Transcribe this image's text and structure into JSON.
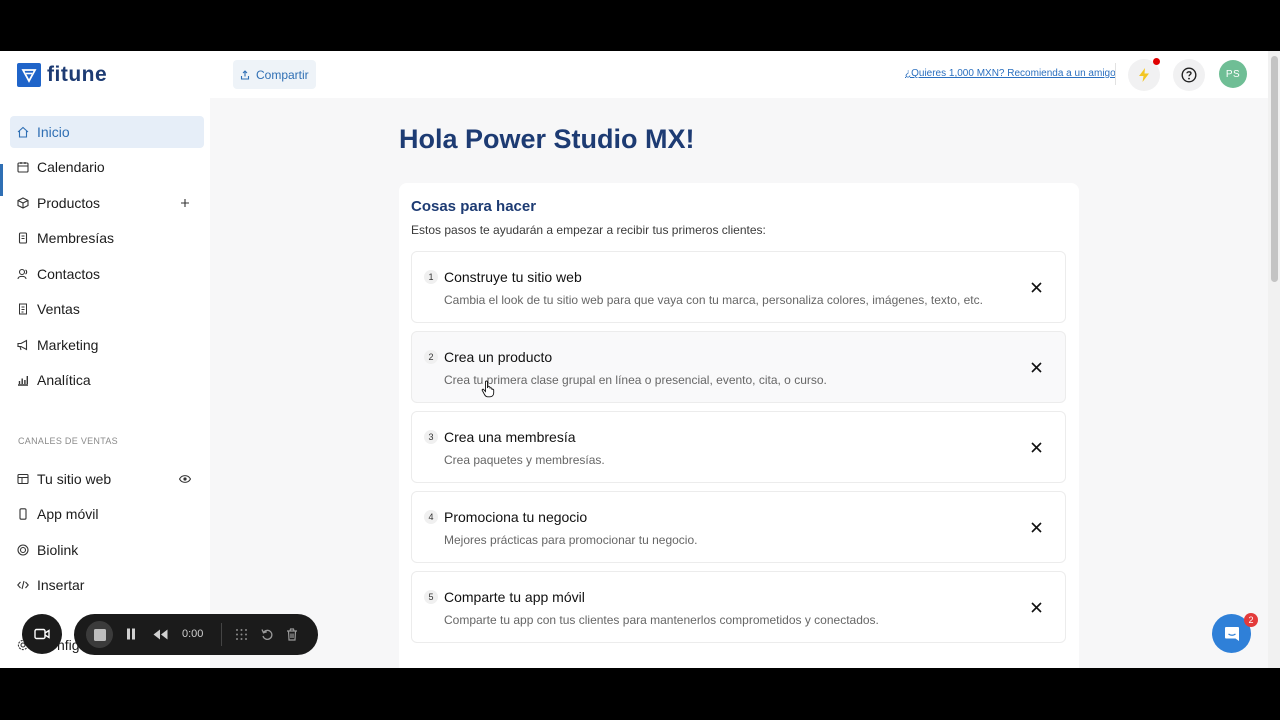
{
  "app": {
    "logo_text": "fitune"
  },
  "header": {
    "share_label": "Compartir",
    "refer_link": "¿Quieres 1,000 MXN? Recomienda a un amigo",
    "avatar_initials": "PS"
  },
  "sidebar": {
    "items": [
      {
        "label": "Inicio",
        "icon": "home-icon"
      },
      {
        "label": "Calendario",
        "icon": "calendar-icon"
      },
      {
        "label": "Productos",
        "icon": "box-icon"
      },
      {
        "label": "Membresías",
        "icon": "membership-icon"
      },
      {
        "label": "Contactos",
        "icon": "contacts-icon"
      },
      {
        "label": "Ventas",
        "icon": "receipt-icon"
      },
      {
        "label": "Marketing",
        "icon": "megaphone-icon"
      },
      {
        "label": "Analítica",
        "icon": "bar-chart-icon"
      }
    ],
    "channels_label": "CANALES DE VENTAS",
    "channels": [
      {
        "label": "Tu sitio web",
        "icon": "website-icon"
      },
      {
        "label": "App móvil",
        "icon": "phone-icon"
      },
      {
        "label": "Biolink",
        "icon": "target-icon"
      },
      {
        "label": "Insertar",
        "icon": "code-icon"
      }
    ],
    "config_partial": "nfig"
  },
  "main": {
    "greeting": "Hola Power Studio MX!",
    "todo": {
      "title": "Cosas para hacer",
      "subtitle": "Estos pasos te ayudarán a empezar a recibir tus primeros clientes:",
      "steps": [
        {
          "num": "1",
          "title": "Construye tu sitio web",
          "desc": "Cambia el look de tu sitio web para que vaya con tu marca, personaliza colores, imágenes, texto, etc."
        },
        {
          "num": "2",
          "title": "Crea un producto",
          "desc": "Crea tu primera clase grupal en línea o presencial, evento, cita, o curso."
        },
        {
          "num": "3",
          "title": "Crea una membresía",
          "desc": "Crea paquetes y membresías."
        },
        {
          "num": "4",
          "title": "Promociona tu negocio",
          "desc": "Mejores prácticas para promocionar tu negocio."
        },
        {
          "num": "5",
          "title": "Comparte tu app móvil",
          "desc": "Comparte tu app con tus clientes para mantenerlos comprometidos y conectados."
        }
      ]
    }
  },
  "recorder": {
    "time": "0:00"
  },
  "chat": {
    "badge": "2"
  },
  "colors": {
    "brand": "#1d3b73",
    "accent": "#2f6fb4",
    "notification": "#e00000",
    "avatar": "#6fbe95",
    "chat": "#2f80d8"
  }
}
